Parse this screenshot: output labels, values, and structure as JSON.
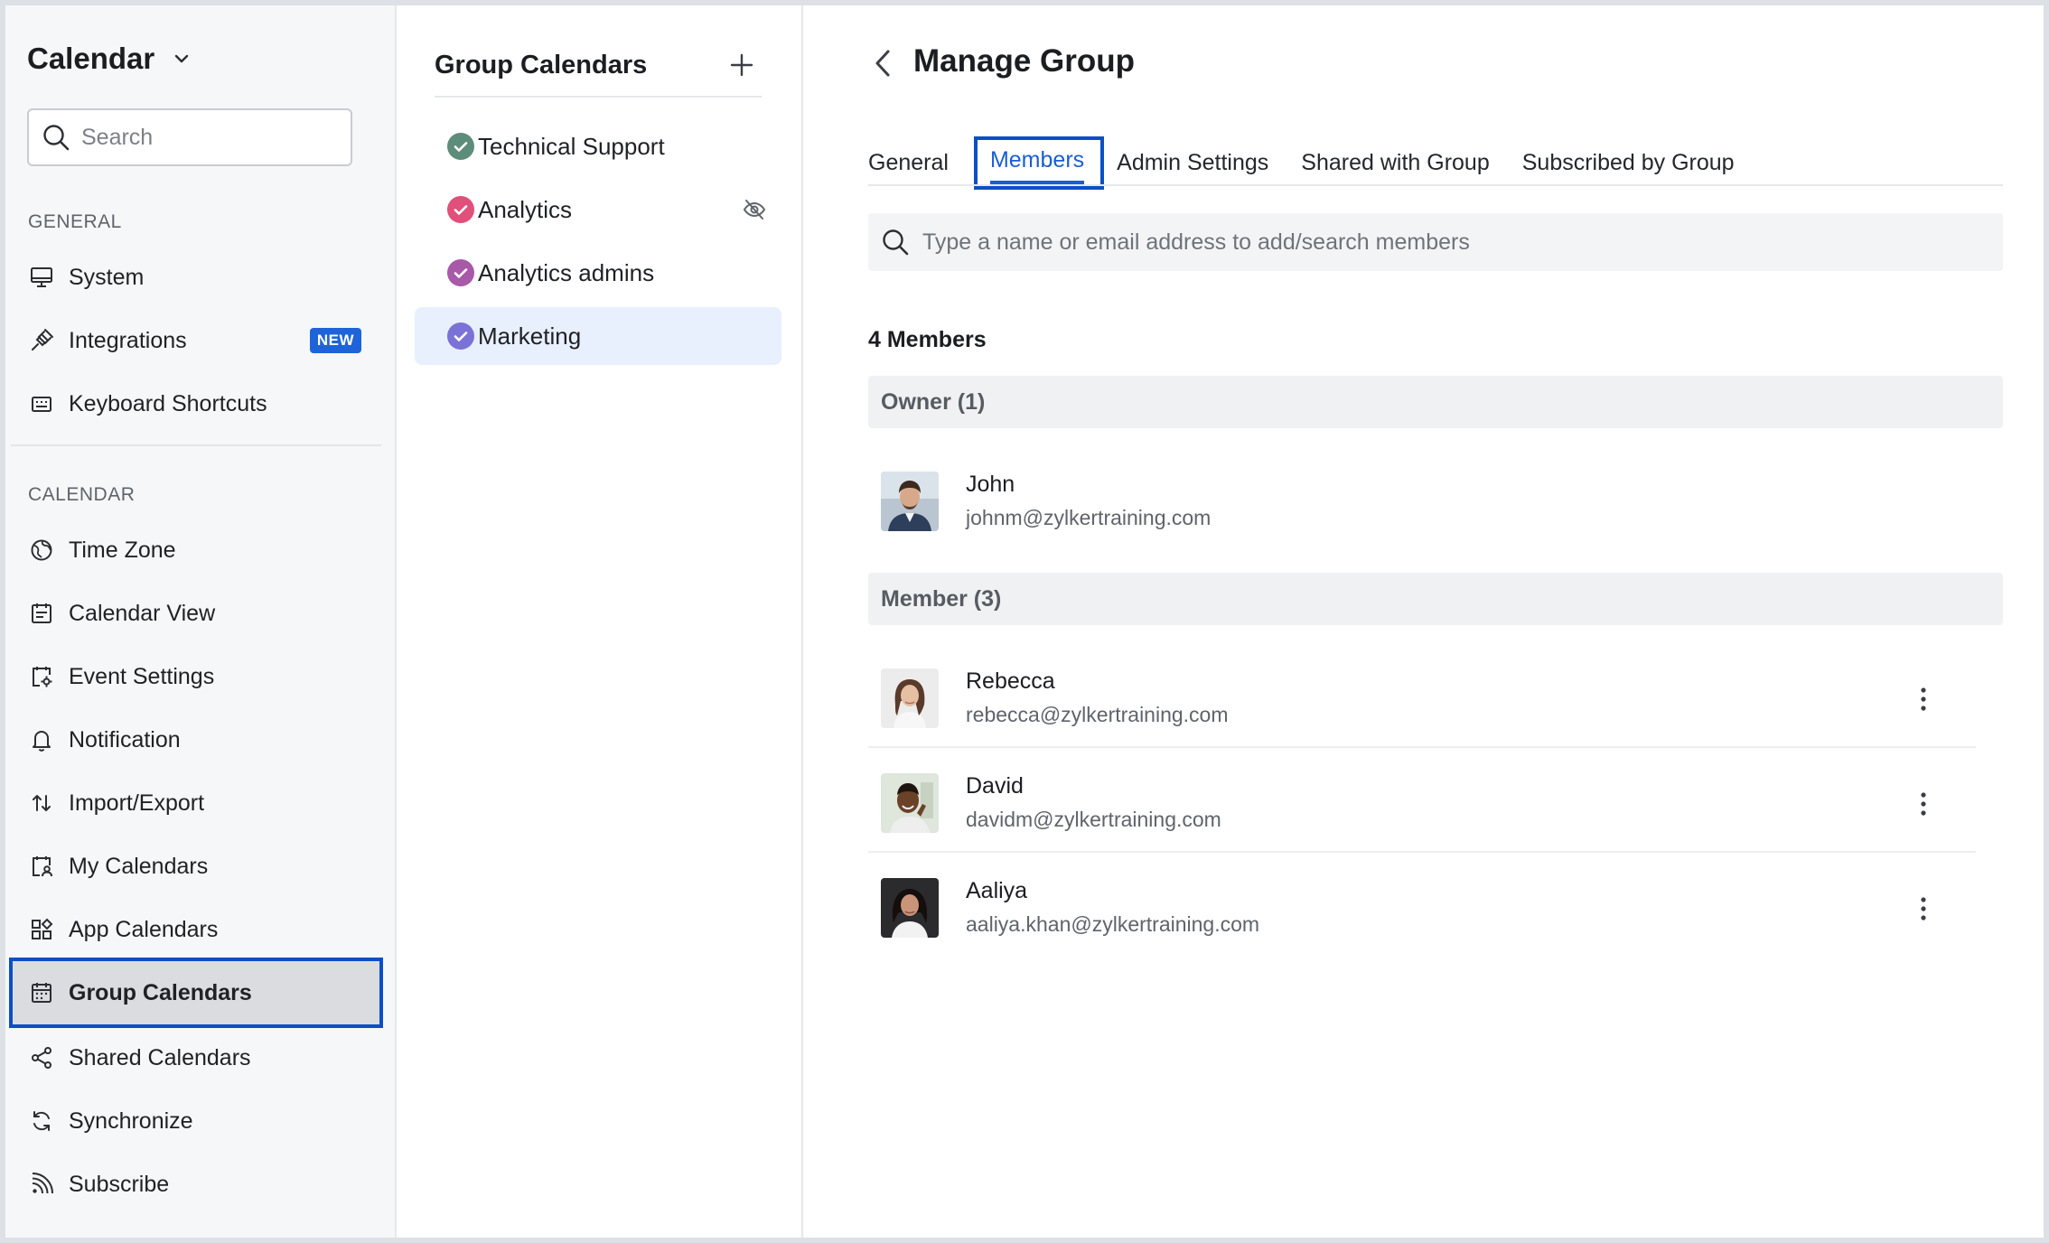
{
  "sidebar": {
    "app_title": "Calendar",
    "search_placeholder": "Search",
    "general_label": "GENERAL",
    "calendar_label": "CALENDAR",
    "badge_new": "NEW",
    "items": [
      {
        "label": "System",
        "icon": "monitor-icon"
      },
      {
        "label": "Integrations",
        "icon": "plug-icon"
      },
      {
        "label": "Keyboard Shortcuts",
        "icon": "keyboard-icon"
      },
      {
        "label": "Time Zone",
        "icon": "globe-icon"
      },
      {
        "label": "Calendar View",
        "icon": "calendar-view-icon"
      },
      {
        "label": "Event Settings",
        "icon": "event-settings-icon"
      },
      {
        "label": "Notification",
        "icon": "bell-icon"
      },
      {
        "label": "Import/Export",
        "icon": "import-export-icon"
      },
      {
        "label": "My Calendars",
        "icon": "my-calendars-icon"
      },
      {
        "label": "App Calendars",
        "icon": "app-calendars-icon"
      },
      {
        "label": "Group Calendars",
        "icon": "group-calendars-icon"
      },
      {
        "label": "Shared Calendars",
        "icon": "share-icon"
      },
      {
        "label": "Synchronize",
        "icon": "sync-icon"
      },
      {
        "label": "Subscribe",
        "icon": "rss-icon"
      }
    ]
  },
  "middle": {
    "title": "Group Calendars",
    "calendars": [
      {
        "label": "Technical Support",
        "color": "#5e8c7a"
      },
      {
        "label": "Analytics",
        "color": "#e0507a"
      },
      {
        "label": "Analytics admins",
        "color": "#a85aa8"
      },
      {
        "label": "Marketing",
        "color": "#7b72d8"
      }
    ]
  },
  "main": {
    "title": "Manage Group",
    "tabs": [
      "General",
      "Members",
      "Admin Settings",
      "Shared with Group",
      "Subscribed by Group"
    ],
    "search_placeholder": "Type a name or email address to add/search members",
    "member_count": "4 Members",
    "owner_header": "Owner (1)",
    "member_header": "Member (3)",
    "owner": {
      "name": "John",
      "email": "johnm@zylkertraining.com"
    },
    "members": [
      {
        "name": "Rebecca",
        "email": "rebecca@zylkertraining.com"
      },
      {
        "name": "David",
        "email": "davidm@zylkertraining.com"
      },
      {
        "name": "Aaliya",
        "email": "aaliya.khan@zylkertraining.com"
      }
    ]
  },
  "colors": {
    "accent": "#1b5ed2",
    "highlight_border": "#0b4fc6",
    "badge": "#1e64d8"
  }
}
